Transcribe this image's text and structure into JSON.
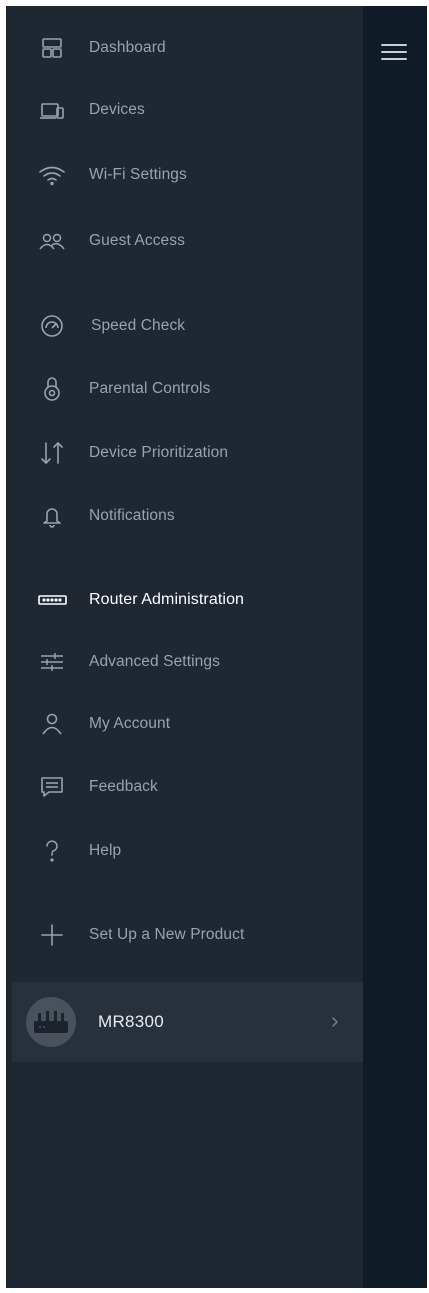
{
  "menu": {
    "toggle_icon": "hamburger-icon",
    "items": [
      {
        "label": "Dashboard",
        "icon": "dashboard-icon"
      },
      {
        "label": "Devices",
        "icon": "devices-icon"
      },
      {
        "label": "Wi-Fi Settings",
        "icon": "wifi-icon"
      },
      {
        "label": "Guest Access",
        "icon": "guest-access-icon"
      },
      {
        "label": "Speed Check",
        "icon": "speedometer-icon"
      },
      {
        "label": "Parental Controls",
        "icon": "parental-controls-icon"
      },
      {
        "label": "Device Prioritization",
        "icon": "prioritization-arrows-icon"
      },
      {
        "label": "Notifications",
        "icon": "bell-icon"
      },
      {
        "label": "Router Administration",
        "icon": "router-icon",
        "active": true
      },
      {
        "label": "Advanced Settings",
        "icon": "sliders-icon"
      },
      {
        "label": "My Account",
        "icon": "user-icon"
      },
      {
        "label": "Feedback",
        "icon": "feedback-icon"
      },
      {
        "label": "Help",
        "icon": "help-icon"
      },
      {
        "label": "Set Up a New Product",
        "icon": "plus-icon"
      }
    ]
  },
  "device": {
    "name": "MR8300",
    "icon": "router-device-image",
    "chevron_icon": "chevron-right-icon"
  },
  "colors": {
    "drawer_background": "#1f2732",
    "outer_background": "#0f1b27",
    "device_row_background": "#27303b",
    "label_text": "#9aa2ad",
    "active_label_text": "#ffffff"
  }
}
